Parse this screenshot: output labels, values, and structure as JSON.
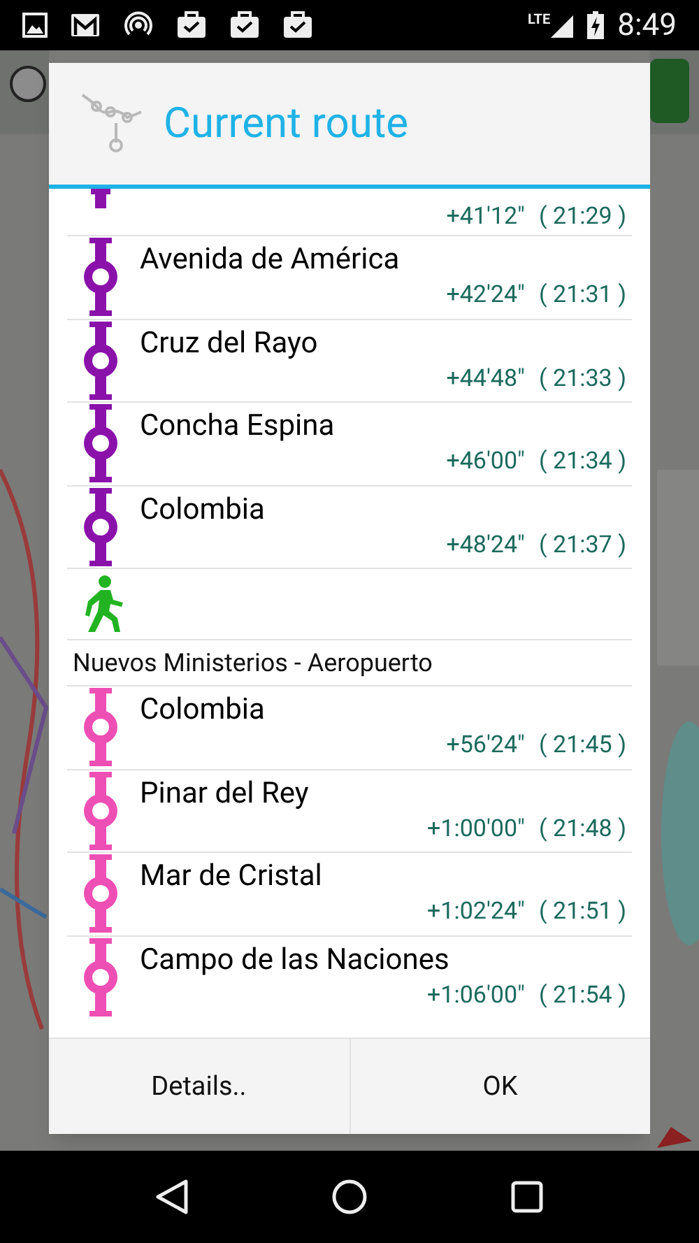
{
  "status_bar": {
    "time": "8:49",
    "network": "LTE"
  },
  "dialog": {
    "title": "Current route",
    "items": [
      {
        "kind": "partial",
        "color": "#8a12aa",
        "offset": "+41'12\"",
        "clock": "( 21:29 )"
      },
      {
        "kind": "stop",
        "color": "#8a12aa",
        "name": "Avenida de América",
        "offset": "+42'24\"",
        "clock": "( 21:31 )"
      },
      {
        "kind": "stop",
        "color": "#8a12aa",
        "name": "Cruz del Rayo",
        "offset": "+44'48\"",
        "clock": "( 21:33 )"
      },
      {
        "kind": "stop",
        "color": "#8a12aa",
        "name": "Concha Espina",
        "offset": "+46'00\"",
        "clock": "( 21:34 )"
      },
      {
        "kind": "stop",
        "color": "#8a12aa",
        "name": "Colombia",
        "offset": "+48'24\"",
        "clock": "( 21:37 )"
      },
      {
        "kind": "walk"
      },
      {
        "kind": "line",
        "name": "Nuevos Ministerios - Aeropuerto"
      },
      {
        "kind": "stop",
        "color": "#ee4fb4",
        "name": "Colombia",
        "offset": "+56'24\"",
        "clock": "( 21:45 )"
      },
      {
        "kind": "stop",
        "color": "#ee4fb4",
        "name": "Pinar del Rey",
        "offset": "+1:00'00\"",
        "clock": "( 21:48 )"
      },
      {
        "kind": "stop",
        "color": "#ee4fb4",
        "name": "Mar de Cristal",
        "offset": "+1:02'24\"",
        "clock": "( 21:51 )"
      },
      {
        "kind": "stop",
        "color": "#ee4fb4",
        "name": "Campo de las Naciones",
        "offset": "+1:06'00\"",
        "clock": "( 21:54 )"
      }
    ],
    "buttons": [
      "Details..",
      "OK"
    ]
  }
}
